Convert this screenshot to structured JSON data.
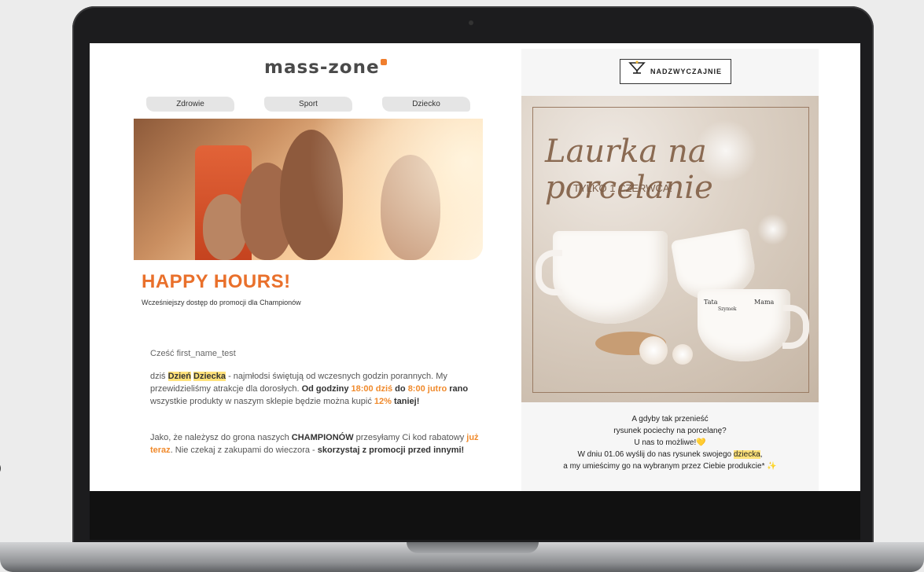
{
  "stray_char": ")",
  "left_email": {
    "logo": "mass-zone",
    "nav": [
      "Zdrowie",
      "Sport",
      "Dziecko"
    ],
    "hero_title": "HAPPY HOURS!",
    "hero_subtitle": "Wcześniejszy dostęp do promocji dla Championów",
    "greeting": "Cześć first_name_test",
    "p1": {
      "a": "dziś ",
      "hl1": "Dzień",
      "hl2": "Dziecka",
      "b": " - najmłodsi świętują od wczesnych godzin porannych. My przewidzieliśmy atrakcje dla dorosłych. ",
      "c": "Od godziny ",
      "d": "18:00 dziś",
      "e": " do ",
      "f": "8:00 jutro",
      "g": " rano",
      "h": " wszystkie produkty w naszym sklepie będzie można kupić ",
      "i": "12%",
      "j": " taniej!"
    },
    "p2": {
      "a": "Jako, że należysz do grona naszych ",
      "b": "CHAMPIONÓW",
      "c": " przesyłamy Ci kod rabatowy ",
      "d": "już teraz",
      "e": ". Nie czekaj z zakupami do wieczora - ",
      "f": "skorzystaj z promocji przed innymi!"
    }
  },
  "right_email": {
    "brand": "NADZWYCZAJNIE",
    "promo_script": "Laurka na porcelanie",
    "promo_sub": "TYLKO 1 CZERWCA!",
    "mug_texts": [
      "Tata",
      "Mama",
      "Szymek"
    ],
    "caption": {
      "l1": "A gdyby tak przenieść",
      "l2": "rysunek pociechy na porcelanę?",
      "l3": "U nas to możliwe!💛",
      "l4a": "W dniu 01.06 wyślij do nas rysunek swojego ",
      "l4b": "dziecka",
      "l4c": ",",
      "l5": "a my umieścimy go na wybranym przez Ciebie produkcie* ✨"
    }
  },
  "colors": {
    "accent": "#e9702b",
    "highlight": "#ffe27a",
    "laptop_body": "#1c1c1e"
  }
}
